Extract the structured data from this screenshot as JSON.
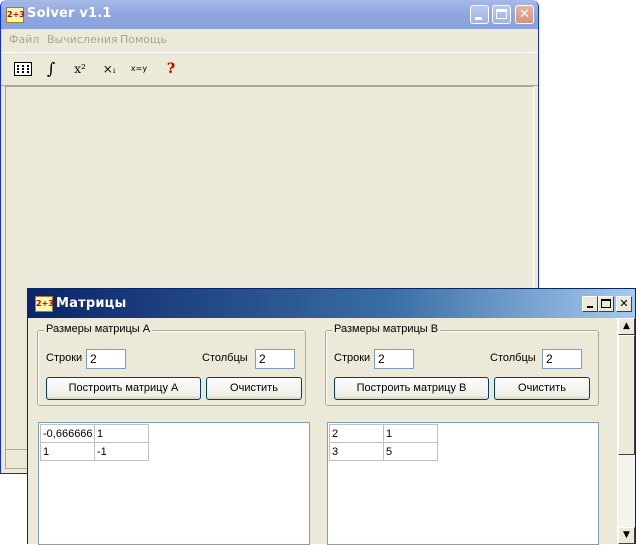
{
  "main_window": {
    "title": "Solver v1.1",
    "icon_text": "2+3",
    "menu": [
      "Файл",
      "Вычисления",
      "Помощь"
    ],
    "toolbar": [
      {
        "name": "matrix-tool",
        "text": "▦"
      },
      {
        "name": "integral-tool",
        "text": "∫"
      },
      {
        "name": "power-tool",
        "text": "x²"
      },
      {
        "name": "roots-tool",
        "text": "×ᵢ"
      },
      {
        "name": "equation-tool",
        "text": "x=y"
      },
      {
        "name": "help-tool",
        "text": "?"
      }
    ]
  },
  "matrices_window": {
    "title": "Матрицы",
    "icon_text": "2+3",
    "matrix_a": {
      "group_label": "Размеры матрицы А",
      "rows_label": "Строки",
      "rows_value": "2",
      "cols_label": "Столбцы",
      "cols_value": "2",
      "build_button": "Построить матрицу А",
      "clear_button": "Очистить",
      "cells": [
        [
          "-0,666666",
          "1"
        ],
        [
          "1",
          "-1"
        ]
      ]
    },
    "matrix_b": {
      "group_label": "Размеры матрицы В",
      "rows_label": "Строки",
      "rows_value": "2",
      "cols_label": "Столбцы",
      "cols_value": "2",
      "build_button": "Построить матрицу В",
      "clear_button": "Очистить",
      "cells": [
        [
          "2",
          "1"
        ],
        [
          "3",
          "5"
        ]
      ]
    }
  },
  "colors": {
    "active_title": "#0a5ce0",
    "inactive_title": "#8fa6e0",
    "window_face": "#ece9d8",
    "help_icon": "#e8b800"
  }
}
